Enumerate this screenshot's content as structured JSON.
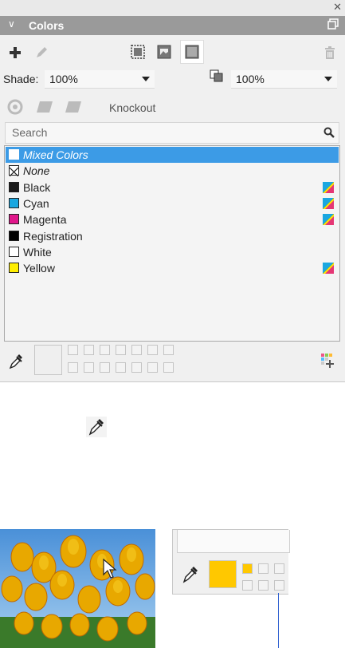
{
  "panel": {
    "title": "Colors",
    "shade_label": "Shade:",
    "shade_value": "100%",
    "opacity_value": "100%",
    "knockout_label": "Knockout",
    "search_placeholder": "Search"
  },
  "colors": [
    {
      "name": "Mixed Colors",
      "swatch": "#ffffff",
      "selected": true,
      "italic": true,
      "process": false
    },
    {
      "name": "None",
      "swatch": "none",
      "selected": false,
      "italic": true,
      "process": false
    },
    {
      "name": "Black",
      "swatch": "#1a1a1a",
      "selected": false,
      "italic": false,
      "process": true
    },
    {
      "name": "Cyan",
      "swatch": "#1aa7e0",
      "selected": false,
      "italic": false,
      "process": true
    },
    {
      "name": "Magenta",
      "swatch": "#e0168a",
      "selected": false,
      "italic": false,
      "process": true
    },
    {
      "name": "Registration",
      "swatch": "#000000",
      "selected": false,
      "italic": false,
      "process": false
    },
    {
      "name": "White",
      "swatch": "#ffffff",
      "selected": false,
      "italic": false,
      "process": false
    },
    {
      "name": "Yellow",
      "swatch": "#ffee00",
      "selected": false,
      "italic": false,
      "process": true
    }
  ],
  "sampled_color": "#ffc800",
  "accent": "#3c9be6",
  "icons": [
    "close-icon",
    "chevron-down-icon",
    "undock-icon",
    "plus-icon",
    "pencil-icon",
    "frame-icon",
    "picture-icon",
    "background-icon",
    "trash-icon",
    "opacity-icon",
    "overprint-icon",
    "search-icon",
    "eyedropper-icon",
    "add-swatch-icon",
    "cursor-icon",
    "process-color-icon"
  ]
}
